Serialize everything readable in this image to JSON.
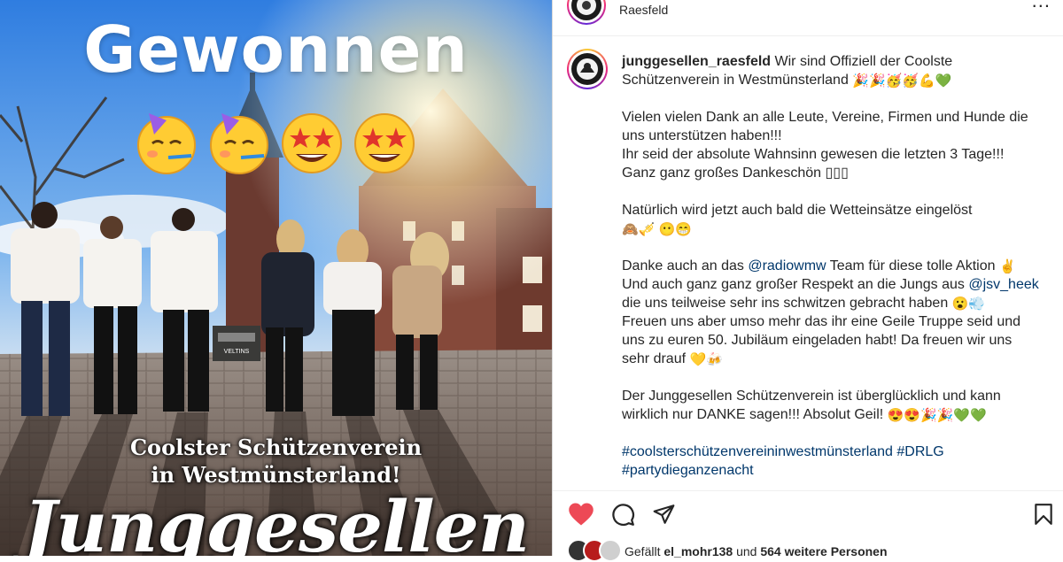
{
  "header": {
    "location": "Raesfeld",
    "more_label": "..."
  },
  "image_overlay": {
    "headline": "Gewonnen",
    "subline_1": "Coolster Schützenverein",
    "subline_2": "in Westmünsterland!",
    "big_text": "Junggesellen",
    "beer_crate_label": "VELTINS"
  },
  "caption": {
    "username": "junggesellen_raesfeld",
    "l1": "Wir sind Offiziell der Coolste Schützenverein in Westmünsterland",
    "l1_emoji": "🎉🎉🥳🥳💪💚",
    "p2a": "Vielen vielen Dank an alle Leute, Vereine, Firmen und Hunde die uns unterstützen haben!!!",
    "p2b": "Ihr seid der absolute Wahnsinn gewesen die letzten 3 Tage!!!",
    "p2c": "Ganz ganz großes Dankeschön",
    "p2c_emoji": "▯▯▯",
    "p3": "Natürlich wird jetzt auch bald die Wetteinsätze eingelöst",
    "p3_emoji": "🙈🎺 😶😁",
    "p4a_pre": "Danke auch an das",
    "p4a_link": "@radiowmw",
    "p4a_post": "Team für diese tolle Aktion",
    "p4a_emoji": "✌",
    "p4b_pre": "Und auch ganz ganz großer Respekt an die Jungs aus",
    "p4b_link": "@jsv_heek",
    "p4c": "die uns teilweise sehr ins schwitzen gebracht haben",
    "p4c_emoji": "😮💨",
    "p4d": "Freuen uns aber umso mehr das ihr eine Geile Truppe seid und uns zu euren 50. Jubiläum eingeladen habt! Da freuen wir uns sehr drauf",
    "p4d_emoji": "💛🍻",
    "p5": "Der Junggesellen Schützenverein ist überglücklich und kann wirklich nur DANKE sagen!!! Absolut Geil!",
    "p5_emoji": "😍😍🎉🎉💚💚",
    "tag1": "#coolsterschützenvereininwestmünsterland",
    "tag2": "#DRLG",
    "tag3": "#partydieganzenacht"
  },
  "likes": {
    "prefix": "Gefällt",
    "user": "el_mohr138",
    "mid": "und",
    "count": "564 weitere Personen"
  },
  "colors": {
    "like": "#ed4956",
    "link": "#00376b",
    "text": "#262626"
  },
  "icons": [
    "heart-icon",
    "comment-icon",
    "share-icon",
    "bookmark-icon",
    "more-icon"
  ]
}
